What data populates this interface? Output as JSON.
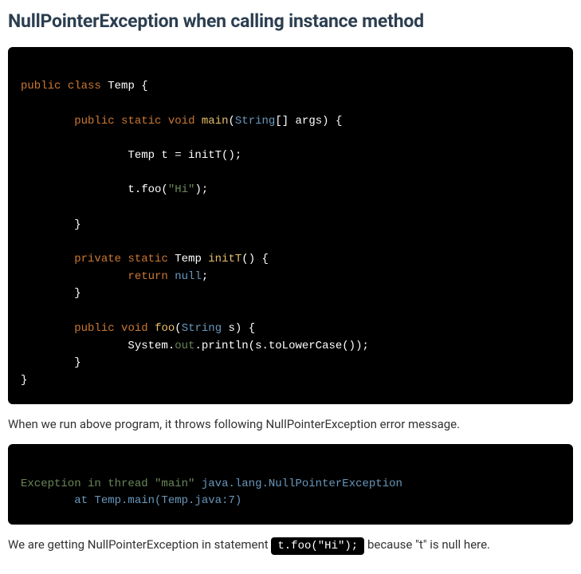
{
  "heading": "NullPointerException when calling instance method",
  "para1": "When we run above program, it throws following NullPointerException error message.",
  "para2_pre": "We are getting NullPointerException in statement ",
  "para2_code": "t.foo(\"Hi\");",
  "para2_post": " because \"t\" is null here.",
  "code1": {
    "tokens": [
      {
        "t": "\n",
        "c": ""
      },
      {
        "t": "public",
        "c": "kw-mod"
      },
      {
        "t": " ",
        "c": ""
      },
      {
        "t": "class",
        "c": "kw-mod"
      },
      {
        "t": " Temp {\n\n",
        "c": ""
      },
      {
        "t": "        ",
        "c": ""
      },
      {
        "t": "public",
        "c": "kw-mod"
      },
      {
        "t": " ",
        "c": ""
      },
      {
        "t": "static",
        "c": "kw-mod"
      },
      {
        "t": " ",
        "c": ""
      },
      {
        "t": "void",
        "c": "kw-type"
      },
      {
        "t": " ",
        "c": ""
      },
      {
        "t": "main",
        "c": "fn"
      },
      {
        "t": "(",
        "c": ""
      },
      {
        "t": "String",
        "c": "ty"
      },
      {
        "t": "[] args) {\n\n",
        "c": ""
      },
      {
        "t": "                Temp t = initT();\n\n",
        "c": ""
      },
      {
        "t": "                t.foo(",
        "c": ""
      },
      {
        "t": "\"Hi\"",
        "c": "str"
      },
      {
        "t": ");\n\n",
        "c": ""
      },
      {
        "t": "        }\n\n",
        "c": ""
      },
      {
        "t": "        ",
        "c": ""
      },
      {
        "t": "private",
        "c": "kw-mod"
      },
      {
        "t": " ",
        "c": ""
      },
      {
        "t": "static",
        "c": "kw-mod"
      },
      {
        "t": " Temp ",
        "c": ""
      },
      {
        "t": "initT",
        "c": "fn"
      },
      {
        "t": "() {\n",
        "c": ""
      },
      {
        "t": "                ",
        "c": ""
      },
      {
        "t": "return",
        "c": "kw-type"
      },
      {
        "t": " ",
        "c": ""
      },
      {
        "t": "null",
        "c": "lit"
      },
      {
        "t": ";\n",
        "c": ""
      },
      {
        "t": "        }\n\n",
        "c": ""
      },
      {
        "t": "        ",
        "c": ""
      },
      {
        "t": "public",
        "c": "kw-mod"
      },
      {
        "t": " ",
        "c": ""
      },
      {
        "t": "void",
        "c": "kw-type"
      },
      {
        "t": " ",
        "c": ""
      },
      {
        "t": "foo",
        "c": "fn"
      },
      {
        "t": "(",
        "c": ""
      },
      {
        "t": "String",
        "c": "ty"
      },
      {
        "t": " s) {\n",
        "c": ""
      },
      {
        "t": "                System.",
        "c": ""
      },
      {
        "t": "out",
        "c": "field"
      },
      {
        "t": ".println(s.toLowerCase());\n",
        "c": ""
      },
      {
        "t": "        }\n",
        "c": ""
      },
      {
        "t": "}\n",
        "c": ""
      }
    ]
  },
  "code2": {
    "tokens": [
      {
        "t": "\n",
        "c": ""
      },
      {
        "t": "Exception in thread ",
        "c": "err-msg"
      },
      {
        "t": "\"main\"",
        "c": "err-msg"
      },
      {
        "t": " ",
        "c": ""
      },
      {
        "t": "java.lang.NullPointerException",
        "c": "err-cls"
      },
      {
        "t": "\n",
        "c": ""
      },
      {
        "t": "        at Temp.main(Temp.java:7)",
        "c": "err-loc"
      },
      {
        "t": "\n",
        "c": ""
      }
    ]
  }
}
